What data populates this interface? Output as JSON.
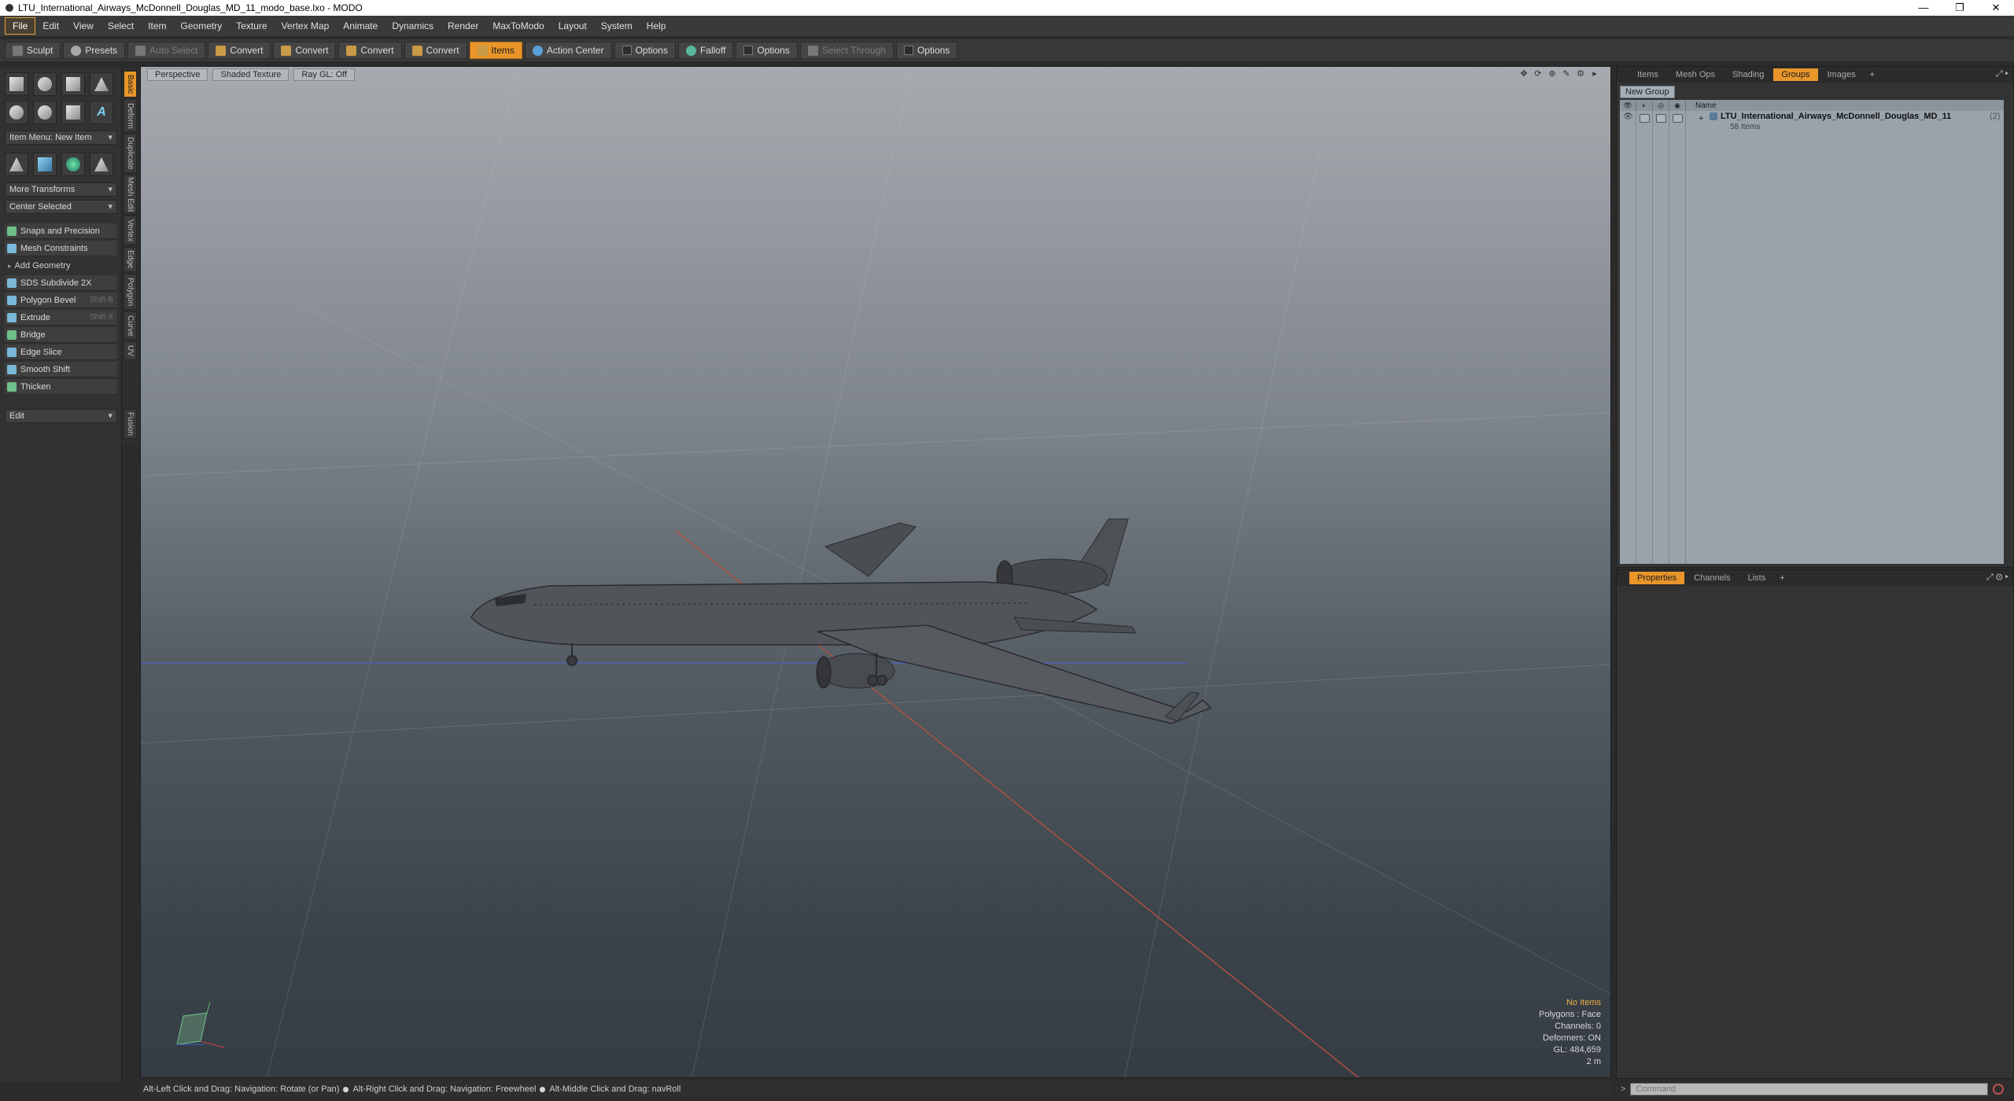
{
  "window": {
    "title": "LTU_International_Airways_McDonnell_Douglas_MD_11_modo_base.lxo - MODO",
    "minimize": "—",
    "maximize": "❐",
    "close": "✕"
  },
  "menu": [
    "File",
    "Edit",
    "View",
    "Select",
    "Item",
    "Geometry",
    "Texture",
    "Vertex Map",
    "Animate",
    "Dynamics",
    "Render",
    "MaxToModo",
    "Layout",
    "System",
    "Help"
  ],
  "toolbar": {
    "sculpt": "Sculpt",
    "presets": "Presets",
    "auto_select": "Auto Select",
    "convert1": "Convert",
    "convert2": "Convert",
    "convert3": "Convert",
    "convert4": "Convert",
    "items": "Items",
    "action_center": "Action Center",
    "options1": "Options",
    "falloff": "Falloff",
    "options2": "Options",
    "select_through": "Select Through",
    "options3": "Options"
  },
  "toolbox": {
    "item_menu": "Item Menu: New Item",
    "more_transforms": "More Transforms",
    "center_selected": "Center Selected",
    "snaps": "Snaps and Precision",
    "mesh_constraints": "Mesh Constraints",
    "add_geometry": "Add Geometry",
    "tools": [
      {
        "label": "SDS Subdivide 2X",
        "shortcut": ""
      },
      {
        "label": "Polygon Bevel",
        "shortcut": "Shift-B"
      },
      {
        "label": "Extrude",
        "shortcut": "Shift-X"
      },
      {
        "label": "Bridge",
        "shortcut": ""
      },
      {
        "label": "Edge Slice",
        "shortcut": ""
      },
      {
        "label": "Smooth Shift",
        "shortcut": ""
      },
      {
        "label": "Thicken",
        "shortcut": ""
      }
    ],
    "edit": "Edit"
  },
  "vtabs": [
    "Basic",
    "Deform",
    "Duplicate",
    "Mesh Edit",
    "Vertex",
    "Edge",
    "Polygon",
    "Curve",
    "UV",
    "Fusion"
  ],
  "viewport": {
    "perspective": "Perspective",
    "shading": "Shaded Texture",
    "raygl": "Ray GL: Off",
    "stats": {
      "items": "No Items",
      "polygons": "Polygons : Face",
      "channels": "Channels: 0",
      "deformers": "Deformers: ON",
      "gl": "GL: 484,659",
      "scale": "2 m"
    }
  },
  "status": {
    "hint1": "Alt-Left Click and Drag: Navigation: Rotate (or Pan)",
    "hint2": "Alt-Right Click and Drag: Navigation: Freewheel",
    "hint3": "Alt-Middle Click and Drag: navRoll"
  },
  "right_top": {
    "tabs": [
      "Items",
      "Mesh Ops",
      "Shading",
      "Groups",
      "Images"
    ],
    "active_tab": "Groups",
    "plus": "+",
    "new_group": "New Group",
    "name_header": "Name",
    "group": {
      "name": "LTU_International_Airways_McDonnell_Douglas_MD_11",
      "count": "(2)",
      "sub": "58 Items"
    }
  },
  "right_bottom": {
    "tabs": [
      "Properties",
      "Channels",
      "Lists"
    ],
    "active_tab": "Properties",
    "plus": "+"
  },
  "command": {
    "prompt": ">",
    "placeholder": "Command"
  },
  "colors": {
    "accent": "#e8962a",
    "viewport_top": "#a6abb0",
    "viewport_bottom": "#353c44"
  }
}
